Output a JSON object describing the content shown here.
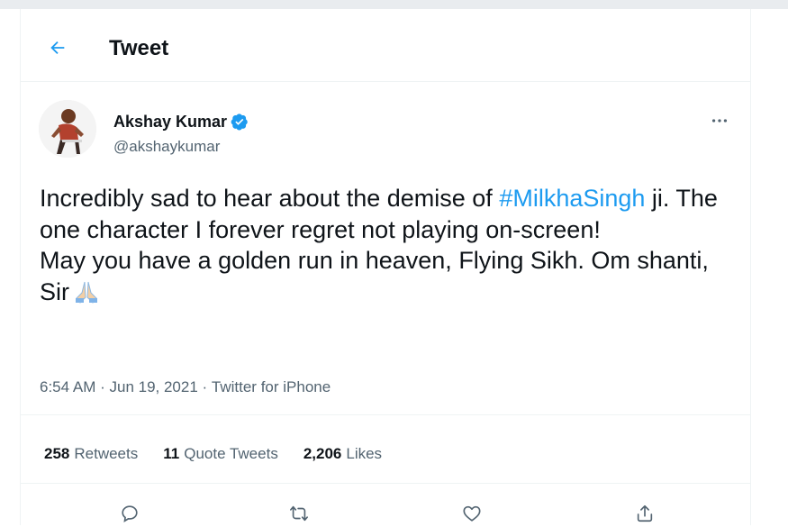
{
  "header": {
    "title": "Tweet",
    "back_icon": "arrow-left-icon"
  },
  "tweet": {
    "author": {
      "name": "Akshay Kumar",
      "handle": "@akshaykumar",
      "verified": true
    },
    "text": {
      "part1": "Incredibly sad to hear about the demise of ",
      "hashtag": "#MilkhaSingh",
      "part2": " ji. The one character I forever regret not playing on-screen!",
      "part3": "May you have a golden run in heaven, Flying Sikh. Om shanti, Sir",
      "emoji": "folded-hands-emoji"
    },
    "time": "6:54 AM",
    "date": "Jun 19, 2021",
    "source": "Twitter for iPhone",
    "separator": " · "
  },
  "stats": {
    "retweets": {
      "count": "258",
      "label": "Retweets"
    },
    "quotes": {
      "count": "11",
      "label": "Quote Tweets"
    },
    "likes": {
      "count": "2,206",
      "label": "Likes"
    }
  },
  "actions": [
    "reply-icon",
    "retweet-icon",
    "like-icon",
    "share-icon"
  ],
  "colors": {
    "accent": "#1d9bf0",
    "text": "#0f1419",
    "secondary": "#536471",
    "border": "#eff3f4"
  }
}
